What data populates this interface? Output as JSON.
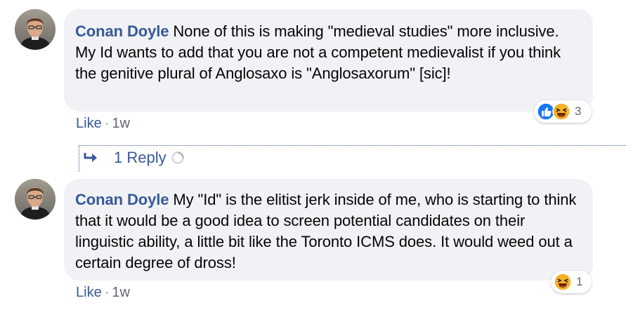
{
  "comments": [
    {
      "author": "Conan Doyle",
      "text": "None of this is making \"medieval studies\" more inclusive. My Id wants to add that you are not a competent medievalist if you think the genitive plural of Anglosaxo is \"Anglosaxorum\" [sic]!",
      "like_label": "Like",
      "separator": "·",
      "time": "1w",
      "reaction_count": "3",
      "reactions": [
        "like-icon",
        "haha-icon"
      ]
    },
    {
      "author": "Conan Doyle",
      "text": "My \"Id\" is the elitist jerk inside of me, who is starting to think that it would be a good idea to screen potential candidates on their linguistic ability, a little bit like the Toronto ICMS does. It would weed out a certain degree of dross!",
      "like_label": "Like",
      "separator": "·",
      "time": "1w",
      "reaction_count": "1",
      "reactions": [
        "haha-icon"
      ]
    }
  ],
  "replies_link": "1 Reply",
  "colors": {
    "author": "#385898",
    "bubble": "#f0f2f5",
    "like_blue": "#1877f2",
    "haha_yellow": "#f7b125"
  }
}
